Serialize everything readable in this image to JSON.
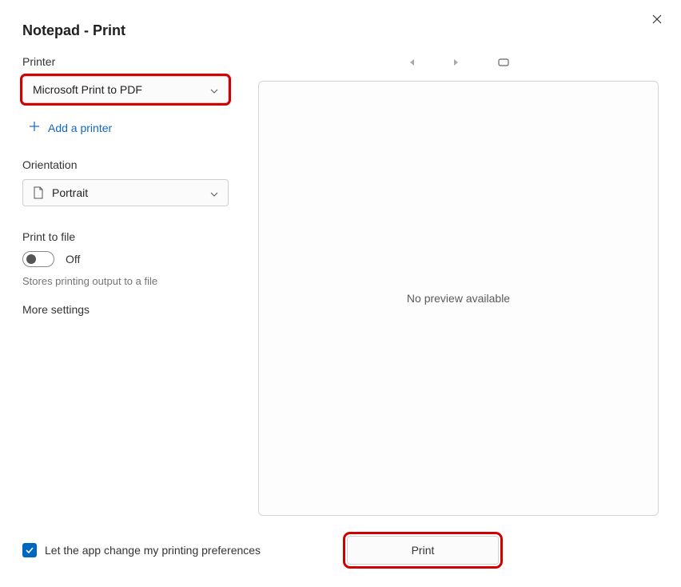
{
  "window": {
    "title": "Notepad - Print"
  },
  "printer": {
    "label": "Printer",
    "selected": "Microsoft Print to PDF",
    "add_label": "Add a printer"
  },
  "orientation": {
    "label": "Orientation",
    "selected": "Portrait"
  },
  "print_to_file": {
    "label": "Print to file",
    "state_label": "Off",
    "hint": "Stores printing output to a file"
  },
  "more_settings": "More settings",
  "preview": {
    "message": "No preview available"
  },
  "footer": {
    "checkbox_label": "Let the app change my printing preferences",
    "print_button": "Print"
  }
}
